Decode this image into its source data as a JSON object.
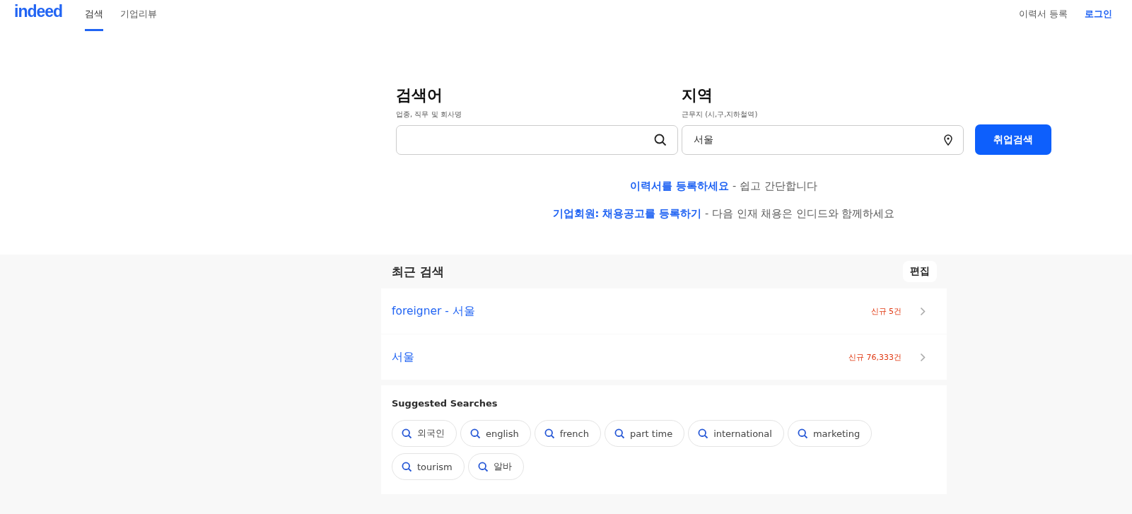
{
  "header": {
    "logo": "indeed",
    "tabs": [
      {
        "label": "검색",
        "selected": true
      },
      {
        "label": "기업리뷰",
        "selected": false
      }
    ],
    "links": [
      {
        "label": "이력서 등록",
        "kind": "plain"
      },
      {
        "label": "로그인",
        "kind": "accent"
      }
    ]
  },
  "search": {
    "what": {
      "label": "검색어",
      "hint": "업종, 직무 및 회사명"
    },
    "where": {
      "label": "지역",
      "hint": "근무지 (시,구,지하철역)",
      "value": "서울"
    },
    "button": "취업검색"
  },
  "promos": [
    {
      "link": "이력서를 등록하세요",
      "text": "- 쉽고 간단합니다"
    },
    {
      "link": "기업회원: 채용공고를 등록하기",
      "text": "- 다음 인재 채용은 인디드와 함께하세요"
    }
  ],
  "recent": {
    "title": "최근 검색",
    "edit": "편집",
    "items": [
      {
        "query": "foreigner - 서울",
        "count": "신규 5건"
      },
      {
        "query": "서울",
        "count": "신규 76,333건"
      }
    ]
  },
  "suggested": {
    "title": "Suggested Searches",
    "chips": [
      "외국인",
      "english",
      "french",
      "part time",
      "international",
      "marketing",
      "tourism",
      "알바"
    ]
  }
}
